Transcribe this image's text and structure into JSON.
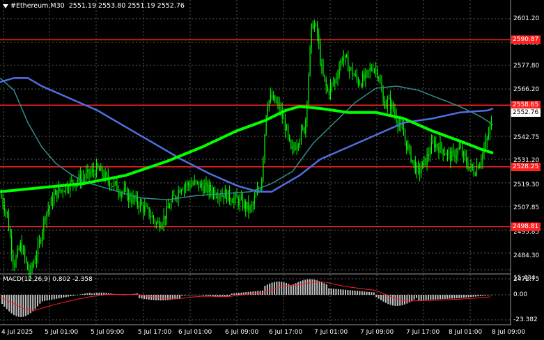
{
  "header": {
    "symbol": "#Ethereum,M30",
    "ohlc": "2551.19 2553.80 2551.19 2552.76"
  },
  "price_axis": [
    "2601.20",
    "2589.35",
    "2577.80",
    "2566.20",
    "2542.75",
    "2531.20",
    "2519.30",
    "2507.85",
    "2495.85",
    "2484.30",
    "2472.75"
  ],
  "horizontal_levels": [
    "2590.87",
    "2558.65",
    "2528.25",
    "2498.81"
  ],
  "current_price": "2552.76",
  "macd": {
    "label": "MACD(12,26,9) 0.802 -2.358",
    "axis": [
      "15.434",
      "0.00",
      "-23.382"
    ]
  },
  "time_axis": [
    "4 Jul 2025",
    "5 Jul 01:00",
    "5 Jul 09:00",
    "5 Jul 17:00",
    "6 Jul 01:00",
    "6 Jul 09:00",
    "6 Jul 17:00",
    "7 Jul 01:00",
    "7 Jul 09:00",
    "7 Jul 17:00",
    "8 Jul 01:00",
    "8 Jul 09:00"
  ],
  "colors": {
    "background": "#000000",
    "grid": "#5a5a5a",
    "candle": "#00ff00",
    "level_line": "#ff2020",
    "ma_fast": "#00ff00",
    "ma_slow": "#4f6fe0",
    "ma_mid": "#2f8f8f",
    "macd_hist": "#c0c0c0",
    "macd_signal": "#ff2020"
  }
}
